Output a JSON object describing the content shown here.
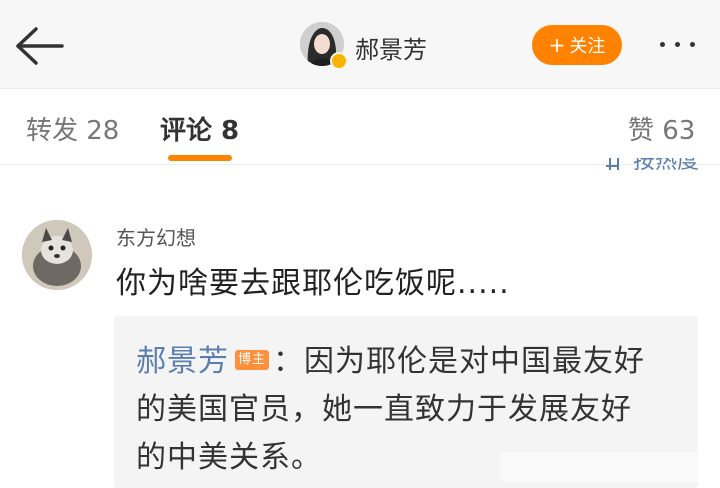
{
  "header": {
    "author_name": "郝景芳",
    "follow_label": "关注",
    "follow_plus": "+"
  },
  "tabs": [
    {
      "label": "转发 28",
      "active": false
    },
    {
      "label": "评论 8",
      "active": true
    },
    {
      "label": "赞 63",
      "active": false
    }
  ],
  "sort": {
    "label": "按热度"
  },
  "comment": {
    "user": "东方幻想",
    "text": "你为啥要去跟耶伦吃饭呢.....",
    "reply": {
      "author": "郝景芳",
      "badge": "博主",
      "separator": "：",
      "line1": "因为耶伦是对中国最友好",
      "line2": "的美国官员，她一直致力于发展友好",
      "line3": "的中美关系。"
    }
  },
  "colors": {
    "accent": "#ff8200",
    "link": "#5a7fae",
    "badge": "#ff8f3a"
  },
  "icons": [
    "back-arrow-icon",
    "more-dots-icon",
    "verified-badge-icon",
    "sort-icon"
  ]
}
